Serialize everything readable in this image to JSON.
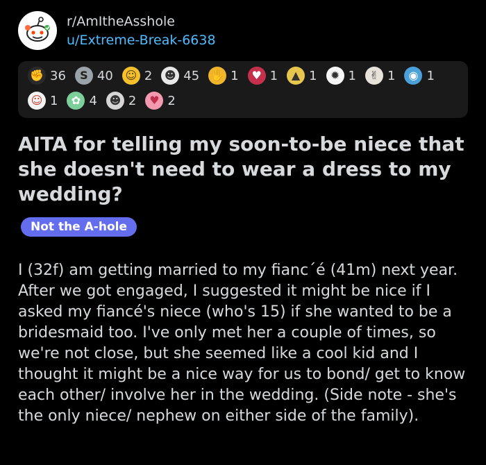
{
  "header": {
    "subreddit": "r/AmItheAsshole",
    "author": "u/Extreme-Break-6638",
    "avatar_icon": "reddit-snoo-icon"
  },
  "awards": [
    {
      "icon": "award-1-icon",
      "glyph": "✊",
      "bg": "#2a2a2a",
      "count": "36"
    },
    {
      "icon": "silver-award-icon",
      "glyph": "S",
      "bg": "#9aa3a8",
      "count": "40"
    },
    {
      "icon": "wholesome-award-icon",
      "glyph": "☺",
      "bg": "#f3c12b",
      "count": "2"
    },
    {
      "icon": "award-4-icon",
      "glyph": "☻",
      "bg": "#e8e8e8",
      "count": "45"
    },
    {
      "icon": "award-5-icon",
      "glyph": "✋",
      "bg": "#f0b52a",
      "count": "1"
    },
    {
      "icon": "heart-award-icon",
      "glyph": "♥",
      "bg": "#c7304d",
      "count": "1"
    },
    {
      "icon": "award-7-icon",
      "glyph": "▲",
      "bg": "#e6c64c",
      "count": "1"
    },
    {
      "icon": "award-8-icon",
      "glyph": "✹",
      "bg": "#f7f7f7",
      "count": "1"
    },
    {
      "icon": "award-9-icon",
      "glyph": "✌",
      "bg": "#e7e2da",
      "count": "1"
    },
    {
      "icon": "award-10-icon",
      "glyph": "◉",
      "bg": "#4ca0d8",
      "count": "1"
    },
    {
      "icon": "award-11-icon",
      "glyph": "☺",
      "bg": "#f2f2f2",
      "count": "1"
    },
    {
      "icon": "award-12-icon",
      "glyph": "✿",
      "bg": "#7ccf9a",
      "count": "4"
    },
    {
      "icon": "award-13-icon",
      "glyph": "☻",
      "bg": "#d6d6d6",
      "count": "2"
    },
    {
      "icon": "award-14-icon",
      "glyph": "♥",
      "bg": "#f39ab0",
      "count": "2"
    }
  ],
  "post": {
    "title": "AITA for telling my soon-to-be niece that she doesn't need to wear a dress to my wedding?",
    "flair": "Not the A-hole",
    "flair_color": "#646ded",
    "body": "I (32f) am getting married to my fianc´é (41m) next year. After we got engaged, I suggested it might be nice if I asked my fiancé's niece (who's 15) if she wanted to be a bridesmaid too. I've only met her a couple of times, so we're not close, but she seemed like a cool kid and I thought it might be a nice way for us to bond/ get to know each other/ involve her in the wedding. (Side note - she's the only niece/ nephew on either side of the family)."
  }
}
